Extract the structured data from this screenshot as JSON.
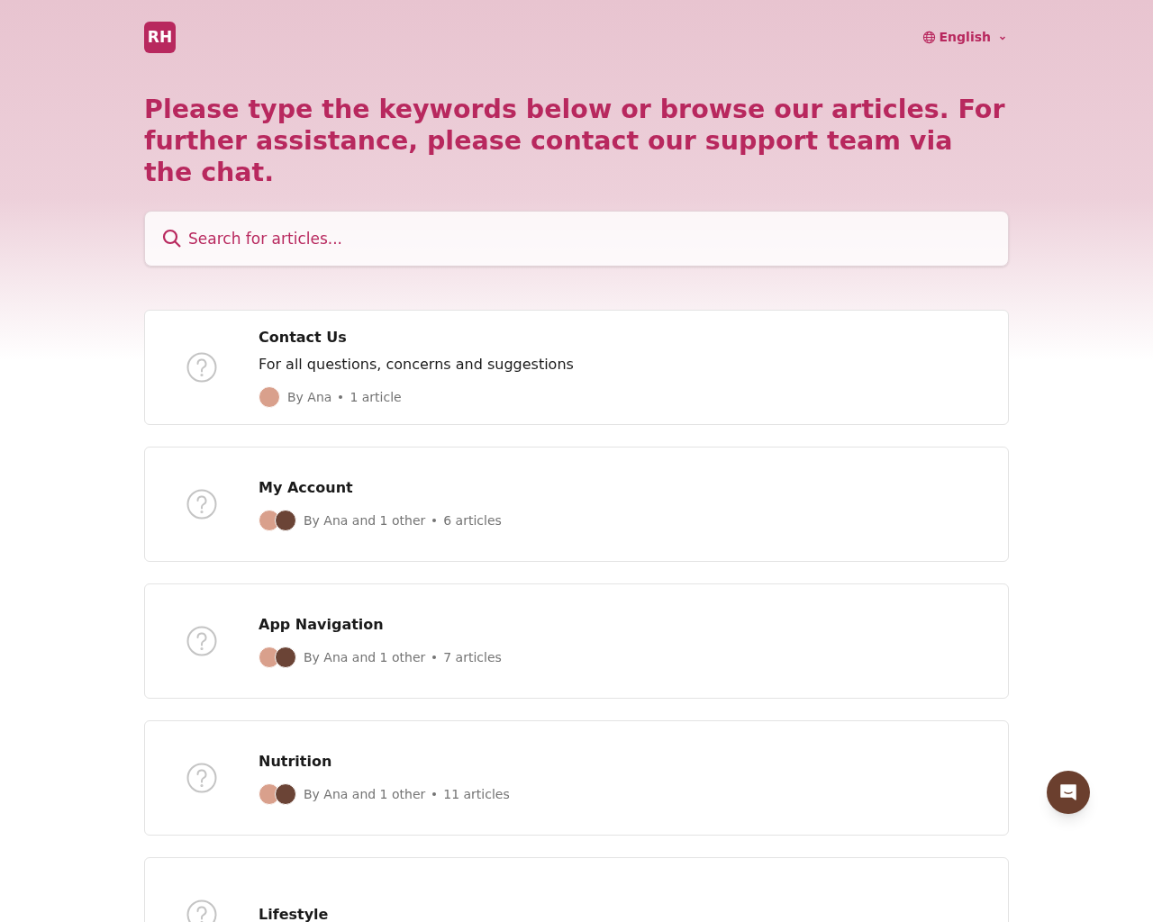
{
  "header": {
    "logo": "RH",
    "language": "English"
  },
  "heading": "Please type the keywords below or browse our articles. For further assistance, please contact our support team via the chat.",
  "search": {
    "placeholder": "Search for articles..."
  },
  "collections": [
    {
      "title": "Contact Us",
      "description": "For all questions, concerns and suggestions",
      "authors": "By Ana",
      "count": "1 article",
      "avatars": [
        {
          "color": "#d9a08c"
        }
      ]
    },
    {
      "title": "My Account",
      "authors": "By Ana and 1 other",
      "count": "6 articles",
      "avatars": [
        {
          "color": "#d9a08c"
        },
        {
          "color": "#6b4436"
        }
      ]
    },
    {
      "title": "App Navigation",
      "authors": "By Ana and 1 other",
      "count": "7 articles",
      "avatars": [
        {
          "color": "#d9a08c"
        },
        {
          "color": "#6b4436"
        }
      ]
    },
    {
      "title": "Nutrition",
      "authors": "By Ana and 1 other",
      "count": "11 articles",
      "avatars": [
        {
          "color": "#d9a08c"
        },
        {
          "color": "#6b4436"
        }
      ]
    },
    {
      "title": "Lifestyle"
    }
  ]
}
